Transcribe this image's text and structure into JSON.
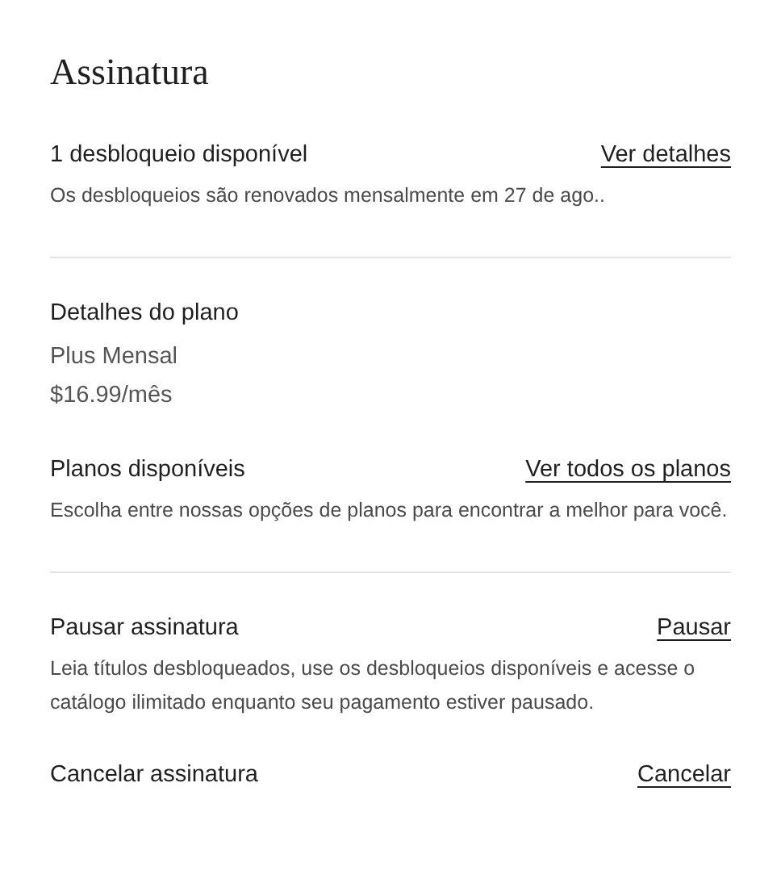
{
  "title": "Assinatura",
  "sections": [
    {
      "heading": "1 desbloqueio disponível",
      "link": "Ver detalhes",
      "description": "Os desbloqueios são renovados mensalmente em 27 de ago..",
      "divider_after": true
    },
    {
      "heading": "Detalhes do plano",
      "lines": [
        "Plus Mensal",
        "$16.99/mês"
      ],
      "divider_after": false
    },
    {
      "heading": "Planos disponíveis",
      "link": "Ver todos os planos",
      "description": "Escolha entre nossas opções de planos para encontrar a melhor para você.",
      "divider_after": true
    },
    {
      "heading": "Pausar assinatura",
      "link": "Pausar",
      "description": "Leia títulos desbloqueados, use os desbloqueios disponíveis e acesse o catálogo ilimitado enquanto seu pagamento estiver pausado.",
      "divider_after": false
    },
    {
      "heading": "Cancelar assinatura",
      "link": "Cancelar",
      "divider_after": false
    }
  ]
}
